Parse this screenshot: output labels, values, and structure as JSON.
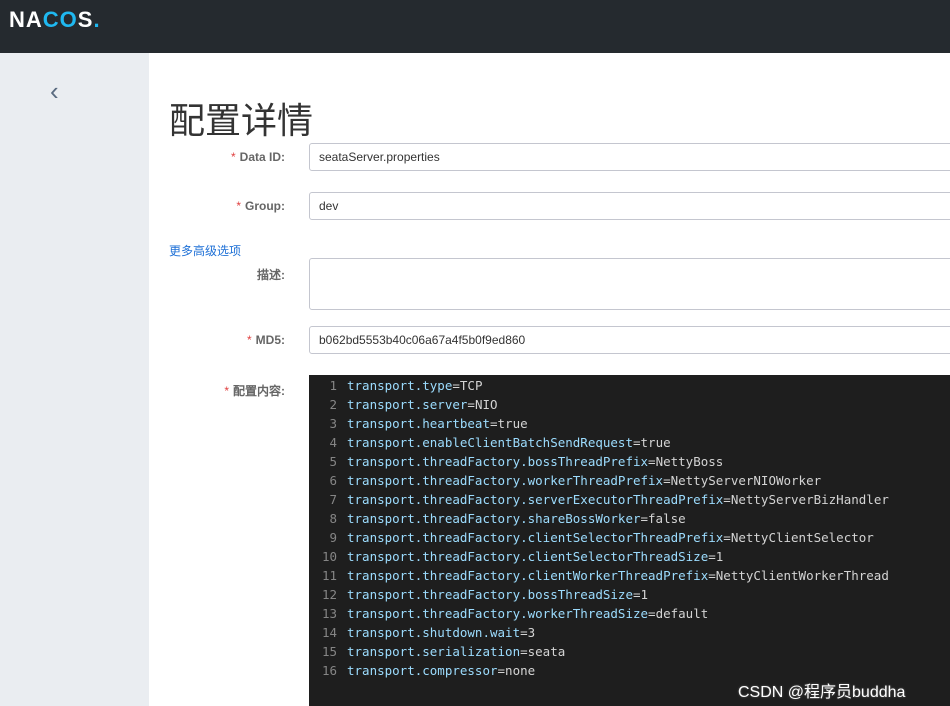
{
  "header": {
    "logo": "NACOS."
  },
  "page": {
    "title": "配置详情",
    "advanced_link": "更多高级选项"
  },
  "form": {
    "data_id": {
      "label": "Data ID:",
      "value": "seataServer.properties",
      "required": true
    },
    "group": {
      "label": "Group:",
      "value": "dev",
      "required": true
    },
    "description": {
      "label": "描述:",
      "value": ""
    },
    "md5": {
      "label": "MD5:",
      "value": "b062bd5553b40c06a67a4f5b0f9ed860",
      "required": true
    },
    "content": {
      "label": "配置内容:",
      "required": true
    }
  },
  "editor_lines": [
    [
      "transport.type",
      "TCP"
    ],
    [
      "transport.server",
      "NIO"
    ],
    [
      "transport.heartbeat",
      "true"
    ],
    [
      "transport.enableClientBatchSendRequest",
      "true"
    ],
    [
      "transport.threadFactory.bossThreadPrefix",
      "NettyBoss"
    ],
    [
      "transport.threadFactory.workerThreadPrefix",
      "NettyServerNIOWorker"
    ],
    [
      "transport.threadFactory.serverExecutorThreadPrefix",
      "NettyServerBizHandler"
    ],
    [
      "transport.threadFactory.shareBossWorker",
      "false"
    ],
    [
      "transport.threadFactory.clientSelectorThreadPrefix",
      "NettyClientSelector"
    ],
    [
      "transport.threadFactory.clientSelectorThreadSize",
      "1"
    ],
    [
      "transport.threadFactory.clientWorkerThreadPrefix",
      "NettyClientWorkerThread"
    ],
    [
      "transport.threadFactory.bossThreadSize",
      "1"
    ],
    [
      "transport.threadFactory.workerThreadSize",
      "default"
    ],
    [
      "transport.shutdown.wait",
      "3"
    ],
    [
      "transport.serialization",
      "seata"
    ],
    [
      "transport.compressor",
      "none"
    ]
  ],
  "watermark": "CSDN @程序员buddha"
}
